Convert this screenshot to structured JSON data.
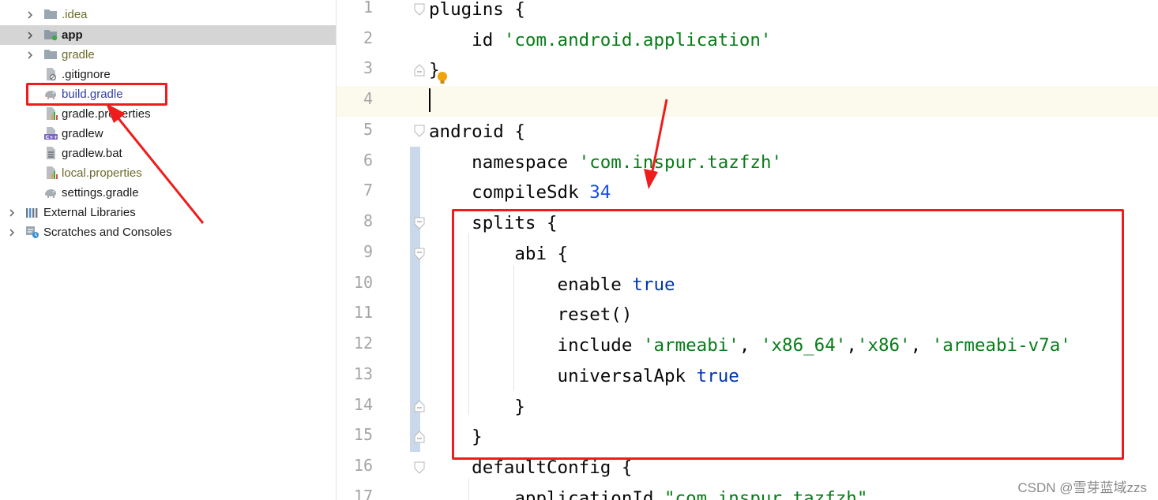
{
  "project_tree": {
    "items": [
      {
        "label": ".idea"
      },
      {
        "label": "app"
      },
      {
        "label": "gradle"
      },
      {
        "label": ".gitignore"
      },
      {
        "label": "build.gradle"
      },
      {
        "label": "gradle.properties"
      },
      {
        "label": "gradlew"
      },
      {
        "label": "gradlew.bat"
      },
      {
        "label": "local.properties"
      },
      {
        "label": "settings.gradle"
      },
      {
        "label": "External Libraries"
      },
      {
        "label": "Scratches and Consoles"
      }
    ],
    "icons": {
      "folder": "folder-icon",
      "module_folder": "module-folder-icon",
      "gitignore_file": "gitignore-file-icon",
      "gradle_file": "gradle-elephant-icon",
      "properties_file": "properties-file-icon",
      "script_file": "shell-script-icon",
      "bat_file": "text-file-icon",
      "libraries": "libraries-icon",
      "scratches": "scratches-icon"
    }
  },
  "editor": {
    "file": "build.gradle",
    "lines": [
      {
        "n": "1",
        "t": [
          "plugins {"
        ]
      },
      {
        "n": "2",
        "t": [
          "    id ",
          "'com.android.application'"
        ]
      },
      {
        "n": "3",
        "t": [
          "}"
        ]
      },
      {
        "n": "4",
        "t": [
          ""
        ]
      },
      {
        "n": "5",
        "t": [
          "android {"
        ]
      },
      {
        "n": "6",
        "t": [
          "    namespace ",
          "'com.inspur.tazfzh'"
        ]
      },
      {
        "n": "7",
        "t": [
          "    compileSdk ",
          "34"
        ]
      },
      {
        "n": "8",
        "t": [
          "    splits {"
        ]
      },
      {
        "n": "9",
        "t": [
          "        abi {"
        ]
      },
      {
        "n": "10",
        "t": [
          "            enable ",
          "true"
        ]
      },
      {
        "n": "11",
        "t": [
          "            reset()"
        ]
      },
      {
        "n": "12",
        "t": [
          "            include ",
          "'armeabi'",
          ", ",
          "'x86_64'",
          ",",
          "'x86'",
          ", ",
          "'armeabi-v7a'"
        ]
      },
      {
        "n": "13",
        "t": [
          "            universalApk ",
          "true"
        ]
      },
      {
        "n": "14",
        "t": [
          "        }"
        ]
      },
      {
        "n": "15",
        "t": [
          "    }"
        ]
      },
      {
        "n": "16",
        "t": [
          "    defaultConfig {"
        ]
      },
      {
        "n": "17",
        "t": [
          "        applicationId ",
          "\"com.inspur.tazfzh\""
        ]
      }
    ]
  },
  "colors": {
    "keyword": "#0033b3",
    "string": "#067d17",
    "number": "#1750eb",
    "annotation_red": "#ee1c1c",
    "selection_gray": "#d5d5d5",
    "caret_line": "#fcfaed"
  },
  "watermark": "CSDN @雪芽蓝域zzs"
}
